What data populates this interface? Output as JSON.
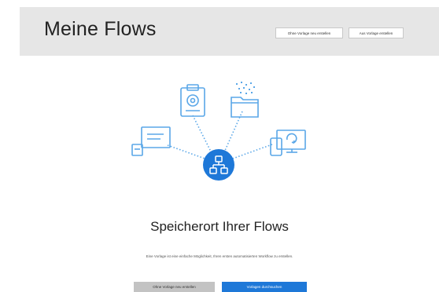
{
  "header": {
    "title": "Meine Flows",
    "create_empty_label": "Ohne Vorlage neu erstellen",
    "create_from_template_label": "Aus Vorlage erstellen"
  },
  "main": {
    "title": "Speicherort Ihrer Flows",
    "description": "Eine Vorlage ist eine einfache Möglichkeit, Ihren ersten automatisierten Workflow zu erstellen.",
    "secondary_button_label": "Ohne Vorlage neu erstellen",
    "primary_button_label": "Vorlagen durchsuchen"
  },
  "illustration": {
    "icons": [
      "chat-icon",
      "clipboard-icon",
      "folder-icon",
      "devices-icon",
      "flow-hub-icon"
    ]
  },
  "colors": {
    "accent": "#1e78d8",
    "icon_line": "#5aa7e8",
    "header_bg": "#e6e6e6",
    "secondary_button_bg": "#c3c3c3"
  }
}
